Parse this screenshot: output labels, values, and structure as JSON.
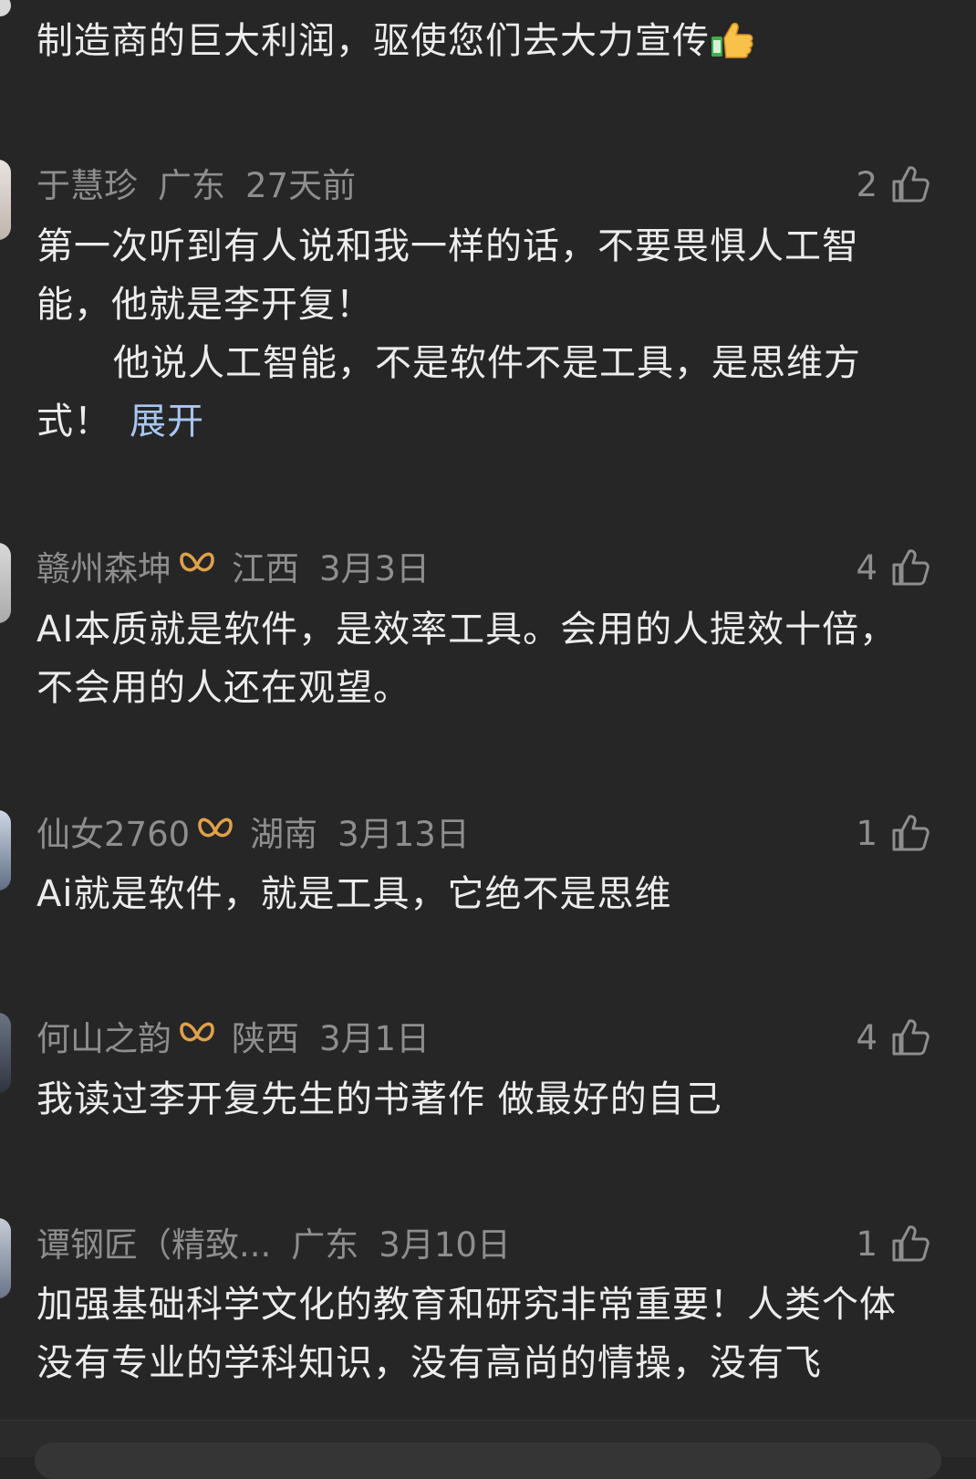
{
  "top_comment": {
    "text": "制造商的巨大利润，驱使您们去大力宣传"
  },
  "comments": [
    {
      "username": "于慧珍",
      "has_badge": false,
      "location": "广东",
      "time": "27天前",
      "likes": "2",
      "lines": [
        "第一次听到有人说和我一样的话，不要畏惧人工智能，他就是李开复！",
        "他说人工智能，不是软件不是工具，是思维方式！"
      ],
      "expand": "展开"
    },
    {
      "username": "赣州森坤",
      "has_badge": true,
      "location": "江西",
      "time": "3月3日",
      "likes": "4",
      "lines": [
        "AI本质就是软件，是效率工具。会用的人提效十倍，不会用的人还在观望。"
      ]
    },
    {
      "username": "仙女2760",
      "has_badge": true,
      "location": "湖南",
      "time": "3月13日",
      "likes": "1",
      "lines": [
        "Ai就是软件，就是工具，它绝不是思维"
      ]
    },
    {
      "username": "何山之韵",
      "has_badge": true,
      "location": "陕西",
      "time": "3月1日",
      "likes": "4",
      "lines": [
        "我读过李开复先生的书著作 做最好的自己"
      ]
    },
    {
      "username": "谭钢匠（精致...",
      "has_badge": false,
      "location": "广东",
      "time": "3月10日",
      "likes": "1",
      "lines": [
        "加强基础科学文化的教育和研究非常重要！人类个体没有专业的学科知识，没有高尚的情操，没有飞"
      ]
    }
  ],
  "colors": {
    "background": "#262626",
    "meta_text": "#8e8e8e",
    "body_text": "#ececec",
    "expand_link": "#a8c6ef",
    "badge": "#e0a14a"
  },
  "icons": {
    "like": "thumbs-up-outline-icon",
    "badge": "fan-badge-icon",
    "emoji": "thumbs-up-emoji"
  }
}
